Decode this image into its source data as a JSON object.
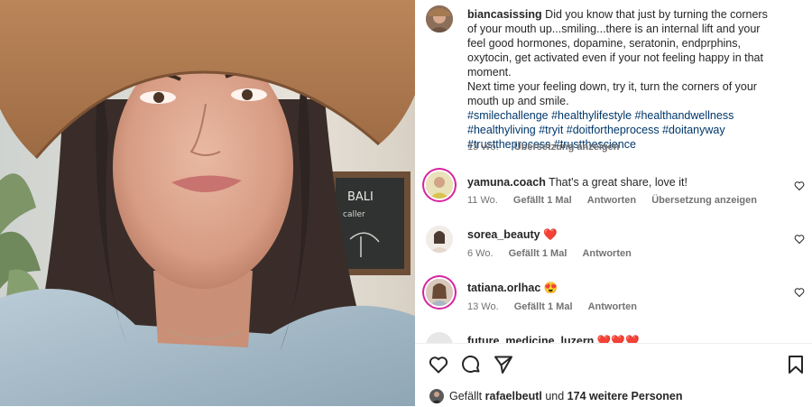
{
  "post": {
    "author": "biancasissing",
    "caption": "Did you know that just by turning the corners of your mouth up...smiling...there is an internal lift and your feel good hormones, dopamine, seratonin, endprphins, oxytocin, get activated even if your not feeling happy in that moment.",
    "caption2": "Next time your feeling down, try it, turn the corners of your mouth up and smile.",
    "hashtags": "#smilechallenge #healthylifestyle #healthandwellness #healthyliving #tryit #doitfortheprocess #doitanyway #trusttheprocess #trustthescience",
    "age": "13 Wo.",
    "translate": "Übersetzung anzeigen"
  },
  "comments": [
    {
      "user": "yamuna.coach",
      "text": "That's a great share, love it!",
      "age": "11 Wo.",
      "likes": "Gefällt 1 Mal",
      "reply": "Antworten",
      "translate": "Übersetzung anzeigen"
    },
    {
      "user": "sorea_beauty",
      "text": "❤️",
      "age": "6 Wo.",
      "likes": "Gefällt 1 Mal",
      "reply": "Antworten"
    },
    {
      "user": "tatiana.orlhac",
      "text": "😍",
      "age": "13 Wo.",
      "likes": "Gefällt 1 Mal",
      "reply": "Antworten"
    },
    {
      "user": "future_medicine_luzern",
      "text": "❤️❤️❤️"
    }
  ],
  "footer": {
    "likes_prefix": "Gefällt",
    "liker": "rafaelbeutl",
    "likes_middle": "und",
    "likes_count": "174 weitere Personen"
  },
  "photo_sign": {
    "line1": "BALI",
    "line2": "caller"
  },
  "colors": {
    "link": "#00376b",
    "muted": "#737373",
    "ring": "#d6249f",
    "text": "#262626"
  },
  "icons": [
    "heart-icon",
    "comment-icon",
    "share-icon",
    "bookmark-icon"
  ]
}
